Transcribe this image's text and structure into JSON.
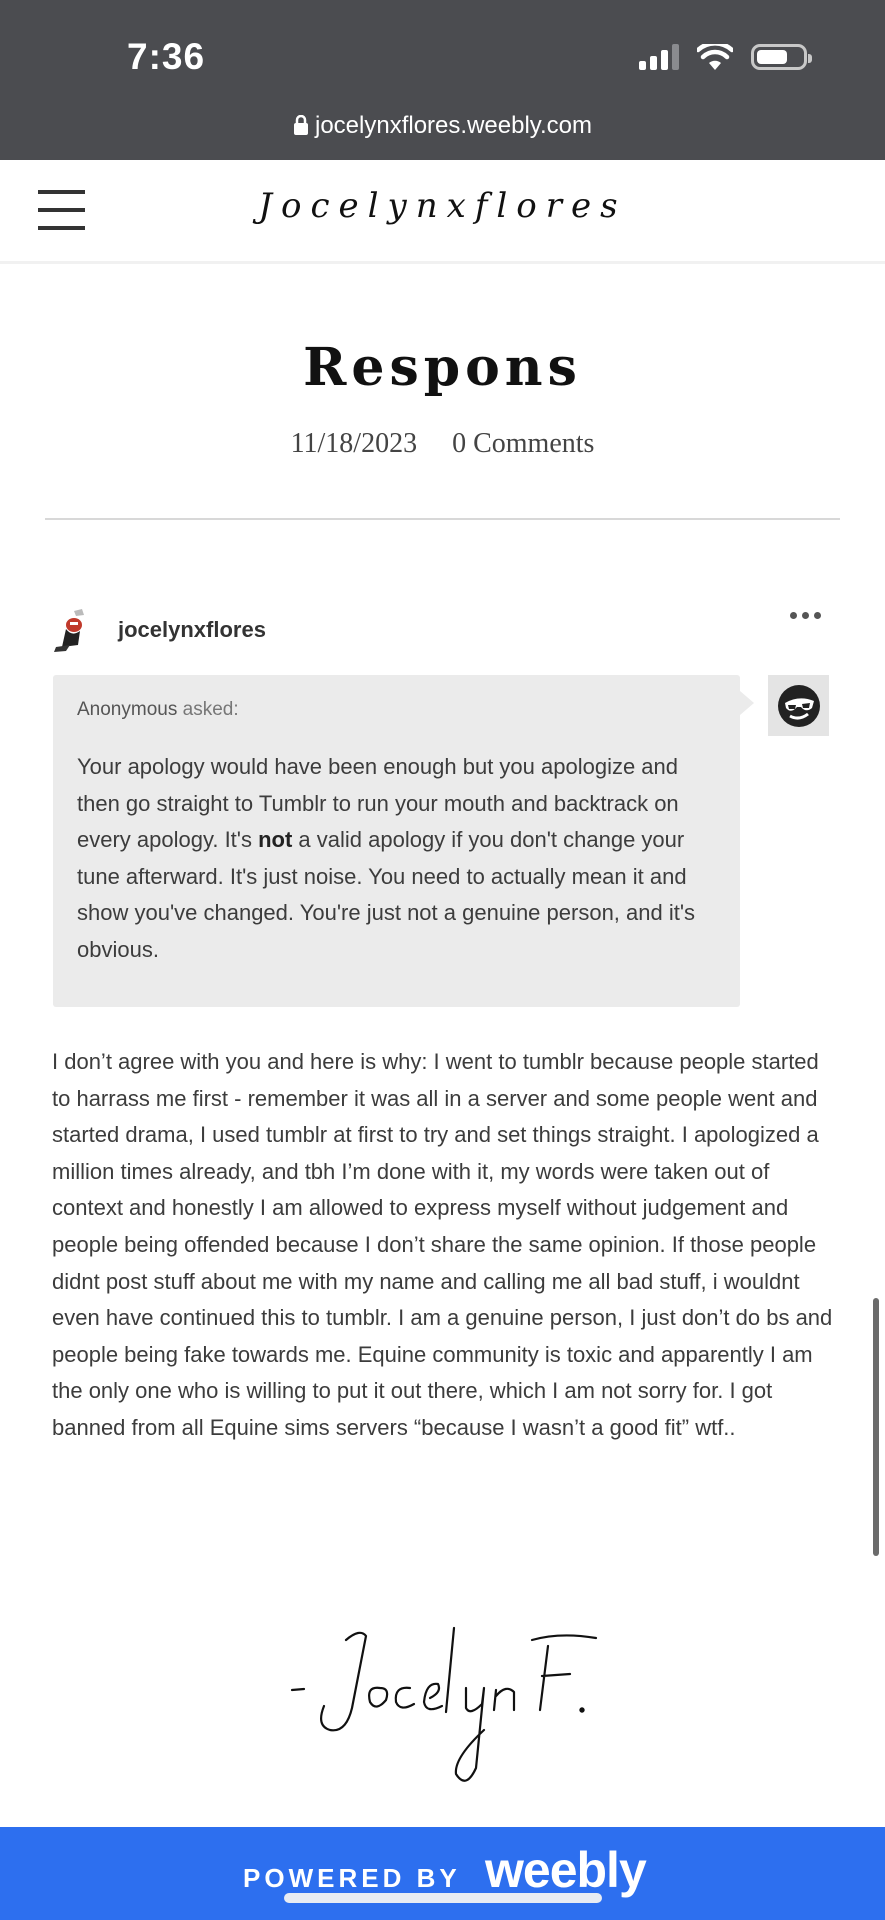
{
  "status_bar": {
    "time": "7:36"
  },
  "browser": {
    "url": "jocelynxflores.weebly.com"
  },
  "site": {
    "logo": "Jocelynxflores"
  },
  "post": {
    "title": "Respons",
    "date": "11/18/2023",
    "comments": "0 Comments"
  },
  "tumblr": {
    "blog_name": "jocelynxflores",
    "asker": "Anonymous",
    "asked_label": "asked:",
    "question_part1": "Your apology would have been enough but you apologize and then go straight to Tumblr to run your mouth and backtrack on every apology. It's ",
    "question_bold": "not",
    "question_part2": " a valid apology if you don't change your tune afterward. It's just noise. You need to actually mean it and show you've changed. You're just not a genuine person, and it's obvious.",
    "answer": "I don’t agree with you and here is why: I went to tumblr because people started to harrass me first - remember it was all in a server and some people went and started drama, I used tumblr at first to try and set things straight. I apologized a million times already, and tbh I’m done with it, my words were taken out of context and honestly I am allowed to express myself without judgement and people being offended because I don’t share the same opinion. If those people didnt post stuff about me with my name and calling me all bad stuff, i wouldnt even have continued this to tumblr. I am a genuine person, I just don’t do bs and people being fake towards me. Equine community is toxic and apparently I am the only one who is willing to put it out there, which I am not sorry for. I got banned from all Equine sims servers “because I wasn’t a good fit” wtf.."
  },
  "signature": "- Jocelyn F.",
  "footer": {
    "powered_by": "POWERED BY",
    "brand": "weebly"
  },
  "colors": {
    "chrome": "#4b4c50",
    "footer": "#2d6fef",
    "ask_bg": "#ebebeb"
  },
  "icons": [
    "signal-icon",
    "wifi-icon",
    "battery-icon",
    "lock-icon",
    "hamburger-icon",
    "more-icon",
    "anon-avatar-icon"
  ]
}
